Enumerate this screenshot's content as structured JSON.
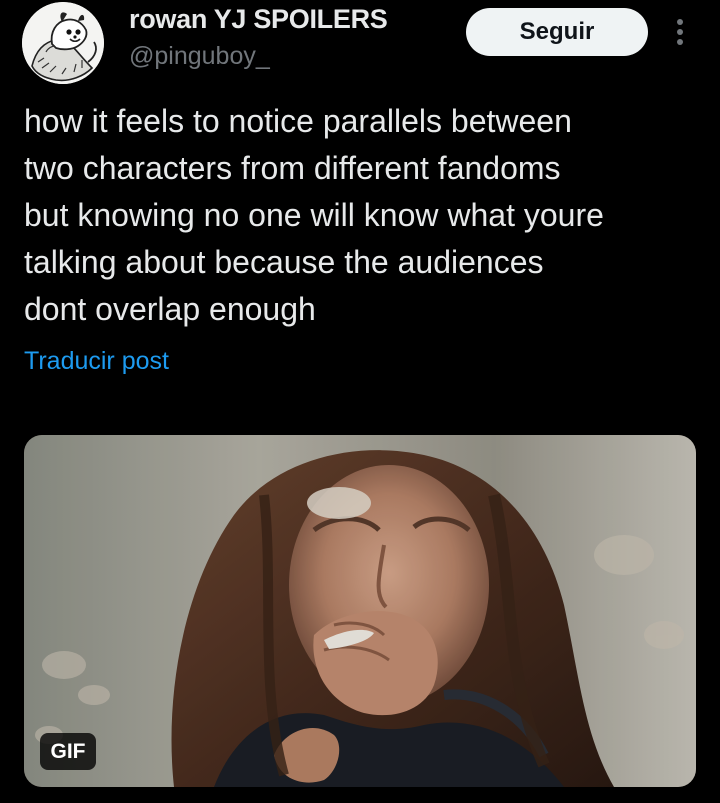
{
  "post": {
    "author": {
      "name": "rowan YJ SPOILERS",
      "handle": "@pinguboy_"
    },
    "follow_label": "Seguir",
    "text_lines": [
      "how it feels to notice parallels between",
      "two characters from different fandoms",
      "but knowing no one will know what youre",
      "talking about because the audiences",
      "dont overlap enough"
    ],
    "translate_label": "Traducir post",
    "media": {
      "badge": "GIF"
    }
  },
  "icons": {
    "more": "more-vertical-icon",
    "avatar": "opossum-drawing-avatar"
  },
  "colors": {
    "background": "#000000",
    "text_primary": "#e7e9ea",
    "text_secondary": "#71767b",
    "link": "#1d9bf0",
    "follow_button_bg": "#eff3f4",
    "follow_button_text": "#0f1419"
  }
}
